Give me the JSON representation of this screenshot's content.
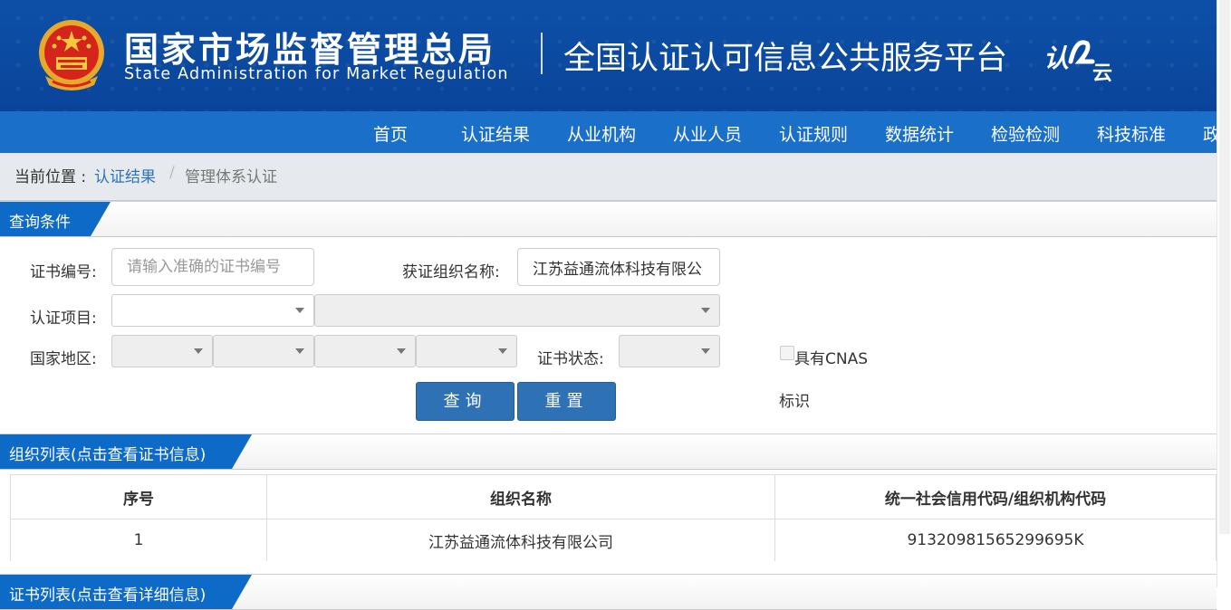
{
  "header": {
    "agency_cn": "国家市场监督管理总局",
    "agency_en": "State Administration  for  Market Regulation",
    "platform_title": "全国认证认可信息公共服务平台",
    "logo_text_a": "认",
    "logo_text_b": "云"
  },
  "nav": {
    "items": [
      "首页",
      "认证结果",
      "从业机构",
      "从业人员",
      "认证规则",
      "数据统计",
      "检验检测",
      "科技标准",
      "政"
    ]
  },
  "breadcrumb": {
    "prefix": "当前位置 : ",
    "link": "认证结果",
    "separator": "/",
    "current": "管理体系认证"
  },
  "query": {
    "section_title": "查询条件",
    "cert_no_label": "证书编号:",
    "cert_no_placeholder": "请输入准确的证书编号",
    "org_name_label": "获证组织名称:",
    "org_name_value": "江苏益通流体科技有限公",
    "project_label": "认证项目:",
    "region_label": "国家地区:",
    "status_label": "证书状态:",
    "cnas_label": "具有CNAS",
    "cnas_label_2": "标识",
    "search_button": "查询",
    "reset_button": "重置"
  },
  "org_list": {
    "section_title": "组织列表(点击查看证书信息)",
    "columns": [
      "序号",
      "组织名称",
      "统一社会信用代码/组织机构代码"
    ],
    "rows": [
      [
        "1",
        "江苏益通流体科技有限公司",
        "91320981565299695K"
      ]
    ]
  },
  "cert_list": {
    "section_title": "证书列表(点击查看详细信息)"
  },
  "colors": {
    "banner_blue": "#0b4aa0",
    "nav_blue": "#1a6fc9",
    "tab_blue": "#0e6ac7",
    "button_blue": "#2e72b5",
    "link_blue": "#2f73b4"
  }
}
